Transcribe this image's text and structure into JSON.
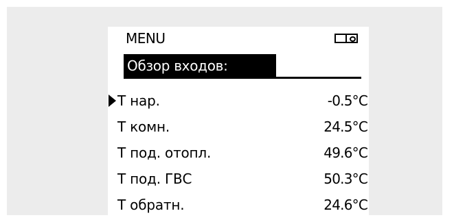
{
  "menu": {
    "title": "MENU",
    "mode_icon": "display-mode-icon"
  },
  "section": {
    "heading": "Обзор входов:"
  },
  "inputs": [
    {
      "label": "T нар.",
      "value": "-0.5°C",
      "selected": true
    },
    {
      "label": "T комн.",
      "value": "24.5°C",
      "selected": false
    },
    {
      "label": "T под. отопл.",
      "value": "49.6°C",
      "selected": false
    },
    {
      "label": "T под. ГВС",
      "value": "50.3°C",
      "selected": false
    },
    {
      "label": "T обратн.",
      "value": "24.6°C",
      "selected": false
    }
  ],
  "colors": {
    "frame_background": "#ececec",
    "screen_background": "#ffffff",
    "text": "#000000",
    "highlight": "#000000"
  }
}
